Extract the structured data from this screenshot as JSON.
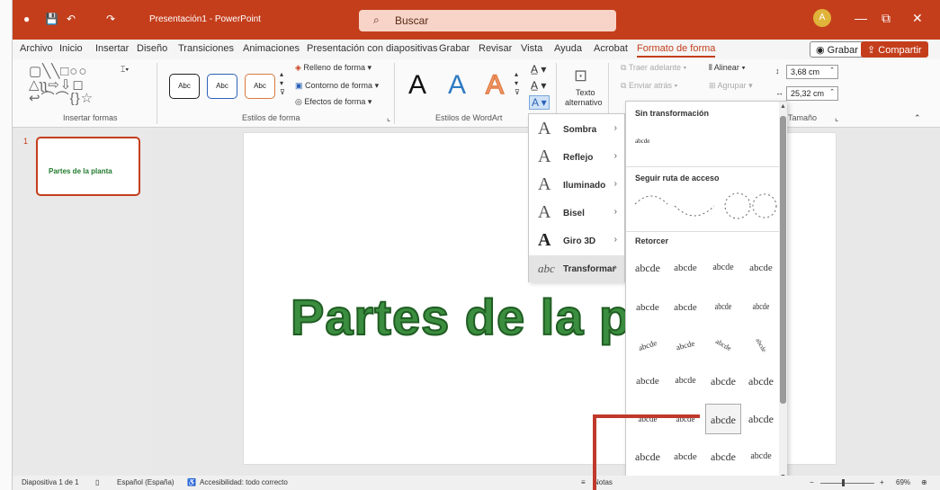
{
  "titlebar": {
    "doc_title": "Presentación1 - PowerPoint",
    "search_placeholder": "Buscar",
    "avatar_initial": "A",
    "minimize": "—",
    "restore": "⧉",
    "close": "✕",
    "save_icon": "💾",
    "undo_icon": "↶",
    "redo_icon": "↷"
  },
  "menu": {
    "tabs": [
      "Archivo",
      "Inicio",
      "Insertar",
      "Diseño",
      "Transiciones",
      "Animaciones",
      "Presentación con diapositivas",
      "Grabar",
      "Revisar",
      "Vista",
      "Ayuda",
      "Acrobat",
      "Formato de forma"
    ],
    "active_tab": "Formato de forma",
    "record_btn": "Grabar",
    "share_btn": "Compartir"
  },
  "ribbon": {
    "insert_shapes_label": "Insertar formas",
    "shape_styles_label": "Estilos de forma",
    "style_samples": [
      "Abc",
      "Abc",
      "Abc"
    ],
    "fill_label": "Relleno de forma",
    "outline_label": "Contorno de forma",
    "effects_label": "Efectos de forma",
    "wordart_label": "Estilos de WordArt",
    "wordart_samples": [
      "A",
      "A",
      "A"
    ],
    "alt_text_line1": "Texto",
    "alt_text_line2": "alternativo",
    "bring_forward": "Traer adelante",
    "send_backward": "Enviar atrás",
    "align": "Alinear",
    "group": "Agrupar",
    "height": "3,68 cm",
    "width": "25,32 cm",
    "size_label": "Tamaño"
  },
  "slides_panel": {
    "slide_number": "1",
    "thumb_title": "Partes de la planta"
  },
  "slide": {
    "title": "Partes de la pl"
  },
  "effects_menu": {
    "items": [
      {
        "glyph": "A",
        "label": "Sombra"
      },
      {
        "glyph": "A",
        "label": "Reflejo"
      },
      {
        "glyph": "A",
        "label": "Iluminado"
      },
      {
        "glyph": "A",
        "label": "Bisel"
      },
      {
        "glyph": "A",
        "label": "Giro 3D"
      },
      {
        "glyph": "abc",
        "label": "Transformar"
      }
    ],
    "arrow": "›"
  },
  "transform_gallery": {
    "no_transform_heading": "Sin transformación",
    "no_transform_sample": "abcde",
    "follow_path_heading": "Seguir ruta de acceso",
    "warp_heading": "Retorcer",
    "warp_rows": [
      [
        "abcde",
        "abcde",
        "abcde",
        "abcde"
      ],
      [
        "abcde",
        "abcde",
        "abcde",
        "abcde"
      ],
      [
        "abcde",
        "abcde",
        "abcde",
        "abcde"
      ],
      [
        "abcde",
        "abcde",
        "abcde",
        "abcde"
      ],
      [
        "abcde",
        "abcde",
        "abcde",
        "abcde"
      ],
      [
        "abcde",
        "abcde",
        "abcde",
        "abcde"
      ]
    ]
  },
  "statusbar": {
    "slide_info": "Diapositiva 1 de 1",
    "language": "Español (España)",
    "accessibility": "Accesibilidad: todo correcto",
    "notes": "Notas",
    "zoom": "69%"
  },
  "colors": {
    "brand": "#c43e1c",
    "wordart_green": "#3b8d3f",
    "annotation_red": "#c0392b"
  }
}
